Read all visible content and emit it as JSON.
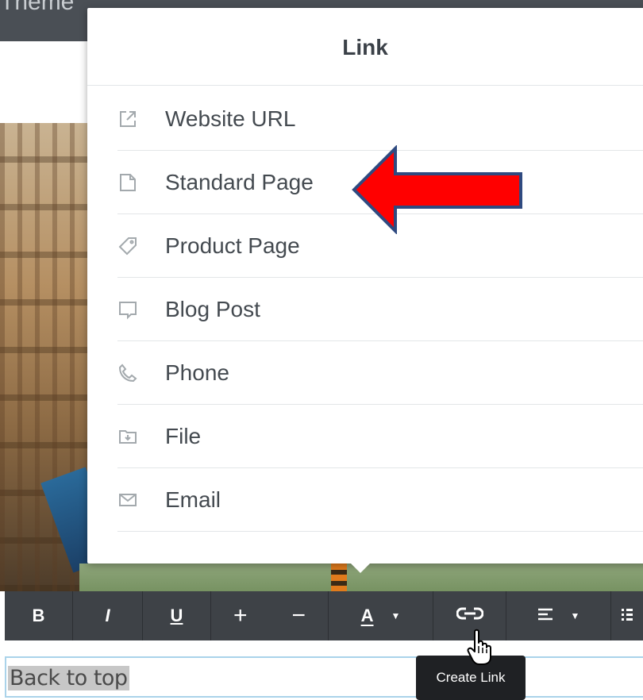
{
  "topbar": {
    "partial_text": "Theme"
  },
  "popup": {
    "title": "Link",
    "items": [
      {
        "label": "Website URL",
        "icon": "external-link-icon"
      },
      {
        "label": "Standard Page",
        "icon": "page-icon"
      },
      {
        "label": "Product Page",
        "icon": "tag-icon"
      },
      {
        "label": "Blog Post",
        "icon": "comment-icon"
      },
      {
        "label": "Phone",
        "icon": "phone-icon"
      },
      {
        "label": "File",
        "icon": "file-folder-icon"
      },
      {
        "label": "Email",
        "icon": "envelope-icon"
      }
    ]
  },
  "annotation": {
    "arrow_color": "#ff0000",
    "arrow_target": "Standard Page"
  },
  "toolbar": {
    "bold": "B",
    "italic": "I",
    "underline": "U",
    "increase": "+",
    "decrease": "−",
    "text_color": "A",
    "link_icon": "link-icon",
    "align_icon": "align-left-icon",
    "list_icon": "list-icon"
  },
  "tooltip": {
    "text": "Create Link"
  },
  "editor": {
    "selected_text": "Back to top"
  },
  "colors": {
    "toolbar_bg": "#3e4247",
    "popup_text": "#444a50",
    "textbox_border": "#aad3ea"
  }
}
